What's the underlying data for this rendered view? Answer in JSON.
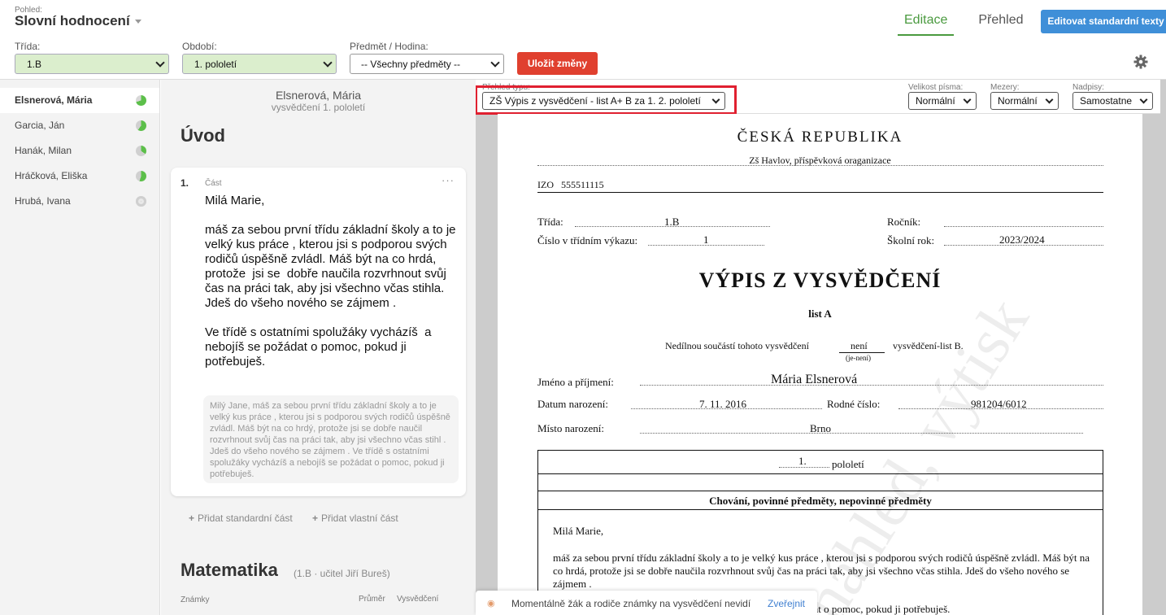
{
  "header": {
    "view_label": "Pohled:",
    "view_value": "Slovní hodnocení",
    "tabs": [
      {
        "label": "Editace",
        "active": true
      },
      {
        "label": "Přehled",
        "active": false
      }
    ],
    "edit_std_button": "Editovat standardní texty",
    "class_label": "Třída:",
    "class_value": "1.B",
    "period_label": "Období:",
    "period_value": "1. pololetí",
    "subject_label": "Předmět / Hodina:",
    "subject_value": "-- Všechny předměty --",
    "save_button": "Uložit změny",
    "accent_color": "#4a9a3f"
  },
  "students": [
    {
      "name": "Elsnerová, Mária",
      "active": true
    },
    {
      "name": "Garcia, Ján",
      "active": false
    },
    {
      "name": "Hanák, Milan",
      "active": false
    },
    {
      "name": "Hráčková, Eliška",
      "active": false
    },
    {
      "name": "Hrubá, Ivana",
      "active": false
    }
  ],
  "editor": {
    "student_name": "Elsnerová, Mária",
    "subtitle": "vysvědčení 1. pololetí",
    "section_title": "Úvod",
    "card": {
      "number": "1.",
      "part_label": "Část",
      "text": "Milá Marie,\n\nmáš za sebou první třídu základní školy a to je velký kus práce , kterou jsi s podporou svých rodičů úspěšně zvládl. Máš být na co hrdá, protože  jsi se  dobře naučila rozvrhnout svůj čas na práci tak, aby jsi všechno včas stihla. Jdeš do všeho nového se zájmem .\n\nVe třídě s ostatními spolužáky vycházíš  a nebojíš se požádat o pomoc, pokud ji potřebuješ.",
      "hint": "Milý Jane, máš za sebou první třídu základní školy a to je velký kus práce , kterou jsi s podporou svých rodičů úspěšně zvládl. Máš být na co hrdý, protože  jsi se dobře naučil rozvrhnout svůj čas na práci tak, aby jsi všechno včas stihl . Jdeš do všeho nového se zájmem . Ve třídě s ostatními spolužáky vycházíš  a nebojíš se požádat o pomoc, pokud ji potřebuješ."
    },
    "add_std_part": "Přidat standardní část",
    "add_own_part": "Přidat vlastní část",
    "math_title": "Matematika",
    "math_sub": "(1.B · učitel Jiří Bureš)",
    "grades_label": "Známky",
    "avg_label": "Průměr",
    "vys_label": "Vysvědčení"
  },
  "preview": {
    "type_label": "Přehled typu:",
    "type_value": "ZŠ Výpis z vysvědčení - list A+ B za 1. 2. pololetí",
    "font_size_label": "Velikost písma:",
    "font_size_value": "Normální",
    "spacing_label": "Mezery:",
    "spacing_value": "Normální",
    "headings_label": "Nadpisy:",
    "headings_value": "Samostatne",
    "doc": {
      "country": "ČESKÁ REPUBLIKA",
      "school": "Zš Havlov, příspěvková oraganizace",
      "izo_label": "IZO",
      "izo": "555511115",
      "class_label": "Třída:",
      "class_value": "1.B",
      "grade_label": "Ročník:",
      "reg_label": "Číslo v třídním výkazu:",
      "reg_value": "1",
      "year_label": "Školní rok:",
      "year_value": "2023/2024",
      "title": "VÝPIS Z VYSVĚDČENÍ",
      "list": "list A",
      "part_of_1": "Nedílnou součástí tohoto vysvědčení",
      "part_of_value": "není",
      "part_of_note": "(je-není)",
      "part_of_2": "vysvědčení-list B.",
      "name_label": "Jméno a příjmení:",
      "name_value": "Mária Elsnerová",
      "dob_label": "Datum narození:",
      "dob_value": "7. 11. 2016",
      "rc_label": "Rodné číslo:",
      "rc_value": "981204/6012",
      "pob_label": "Místo narození:",
      "pob_value": "Brno",
      "period_num": "1.",
      "period_word": "pololetí",
      "section": "Chování, povinné předměty, nepovinné předměty",
      "greeting": "Milá Marie,",
      "body": "máš za sebou první třídu základní školy a to je velký kus práce , kterou jsi s podporou svých rodičů úspěšně zvládl. Máš být na co hrdá, protože  jsi se  dobře naučila rozvrhnout svůj čas na práci tak, aby jsi všechno včas stihla. Jdeš do všeho nového se zájmem .",
      "tail": "dat o pomoc, pokud ji potřebuješ."
    },
    "notice_text": "Momentálně žák a rodiče známky na vysvědčení nevidí",
    "notice_link": "Zveřejnit",
    "highlight_color": "#e02030"
  }
}
